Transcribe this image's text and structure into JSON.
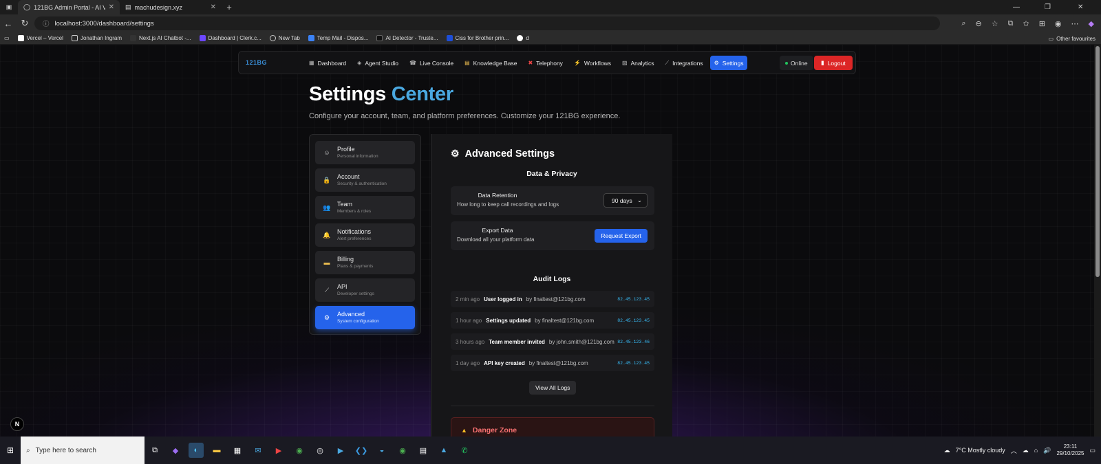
{
  "browser": {
    "tabs": [
      {
        "title": "121BG Admin Portal - AI Voice Ag",
        "active": true
      },
      {
        "title": "machudesign.xyz",
        "active": false
      }
    ],
    "url": "localhost:3000/dashboard/settings",
    "bookmarks": [
      "Vercel – Vercel",
      "Jonathan Ingram",
      "Next.js AI Chatbot -...",
      "Dashboard | Clerk.c...",
      "New Tab",
      "Temp Mail - Dispos...",
      "AI Detector - Truste...",
      "Ciss for Brother prin...",
      "d"
    ],
    "other_favourites": "Other favourites"
  },
  "topnav": {
    "logo": "121BG",
    "items": [
      {
        "label": "Dashboard",
        "icon": "▦"
      },
      {
        "label": "Agent Studio",
        "icon": "◈"
      },
      {
        "label": "Live Console",
        "icon": "☎"
      },
      {
        "label": "Knowledge Base",
        "icon": "▤"
      },
      {
        "label": "Telephony",
        "icon": "✖"
      },
      {
        "label": "Workflows",
        "icon": "⚡"
      },
      {
        "label": "Analytics",
        "icon": "▧"
      },
      {
        "label": "Integrations",
        "icon": "⟋"
      },
      {
        "label": "Settings",
        "icon": "⚙"
      }
    ],
    "status": "Online",
    "logout": "Logout",
    "accent": "#2563eb"
  },
  "hero": {
    "title_main": "Settings",
    "title_accent": "Center",
    "subtitle": "Configure your account, team, and platform preferences. Customize your 121BG experience."
  },
  "sidebar": {
    "items": [
      {
        "label": "Profile",
        "sub": "Personal information",
        "icon": "☺"
      },
      {
        "label": "Account",
        "sub": "Security & authentication",
        "icon": "🔒"
      },
      {
        "label": "Team",
        "sub": "Members & roles",
        "icon": "👥"
      },
      {
        "label": "Notifications",
        "sub": "Alert preferences",
        "icon": "🔔"
      },
      {
        "label": "Billing",
        "sub": "Plans & payments",
        "icon": "▬"
      },
      {
        "label": "API",
        "sub": "Developer settings",
        "icon": "⟋"
      },
      {
        "label": "Advanced",
        "sub": "System configuration",
        "icon": "⚙"
      }
    ],
    "active_index": 6
  },
  "panel": {
    "title": "Advanced Settings",
    "privacy": {
      "heading": "Data & Privacy",
      "retention_title": "Data Retention",
      "retention_desc": "How long to keep call recordings and logs",
      "retention_value": "90 days",
      "export_title": "Export Data",
      "export_desc": "Download all your platform data",
      "export_button": "Request Export"
    },
    "audit": {
      "heading": "Audit Logs",
      "logs": [
        {
          "time": "2 min ago",
          "action": "User logged in",
          "by": "by finaltest@121bg.com",
          "ip": "82.45.123.45"
        },
        {
          "time": "1 hour ago",
          "action": "Settings updated",
          "by": "by finaltest@121bg.com",
          "ip": "82.45.123.45"
        },
        {
          "time": "3 hours ago",
          "action": "Team member invited",
          "by": "by john.smith@121bg.com",
          "ip": "82.45.123.46"
        },
        {
          "time": "1 day ago",
          "action": "API key created",
          "by": "by finaltest@121bg.com",
          "ip": "82.45.123.45"
        }
      ],
      "view_all": "View All Logs"
    },
    "danger": {
      "heading": "Danger Zone"
    }
  },
  "taskbar": {
    "search_placeholder": "Type here to search",
    "weather": "7°C  Mostly cloudy",
    "time": "23:11",
    "date": "29/10/2025"
  }
}
